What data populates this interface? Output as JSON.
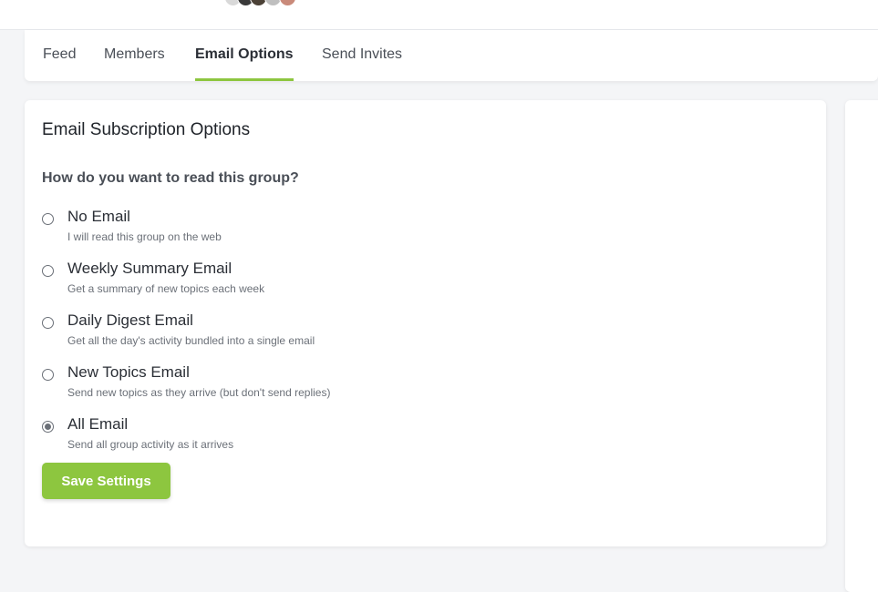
{
  "tabs": [
    {
      "label": "Feed",
      "active": false
    },
    {
      "label": "Members",
      "active": false
    },
    {
      "label": "Email Options",
      "active": true
    },
    {
      "label": "Send Invites",
      "active": false
    }
  ],
  "card": {
    "title": "Email Subscription Options",
    "question": "How do you want to read this group?",
    "options": [
      {
        "label": "No Email",
        "description": "I will read this group on the web",
        "selected": false
      },
      {
        "label": "Weekly Summary Email",
        "description": "Get a summary of new topics each week",
        "selected": false
      },
      {
        "label": "Daily Digest Email",
        "description": "Get all the day's activity bundled into a single email",
        "selected": false
      },
      {
        "label": "New Topics Email",
        "description": "Send new topics as they arrive (but don't send replies)",
        "selected": false
      },
      {
        "label": "All Email",
        "description": "Send all group activity as it arrives",
        "selected": true
      }
    ],
    "save_label": "Save Settings"
  },
  "colors": {
    "accent": "#8dc63f",
    "background": "#f4f5f7"
  }
}
